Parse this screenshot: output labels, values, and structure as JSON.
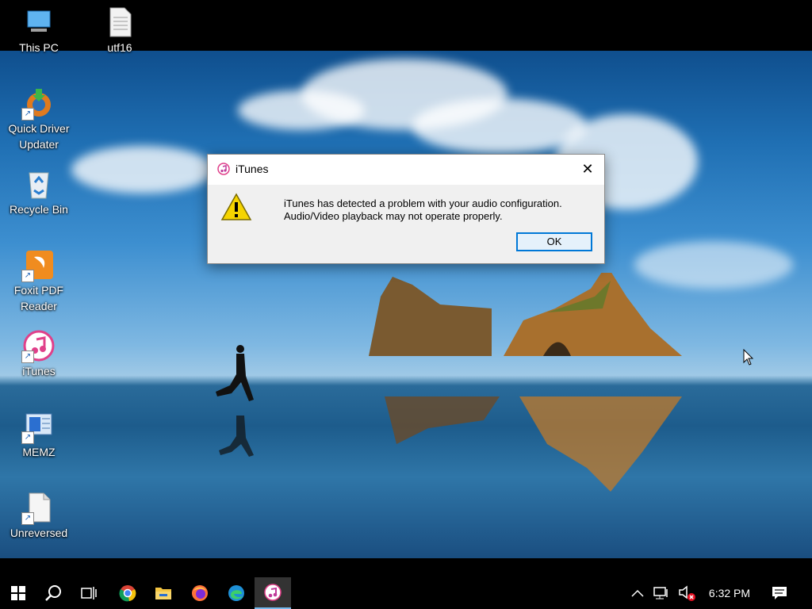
{
  "desktop": {
    "icons": [
      {
        "label": "This PC",
        "icon": "this-pc-icon"
      },
      {
        "label": "utf16",
        "icon": "text-file-icon"
      },
      {
        "label": "Quick Driver Updater",
        "label_line1": "Quick Driver",
        "label_line2": "Updater",
        "icon": "quick-driver-updater-icon"
      },
      {
        "label": "Recycle Bin",
        "icon": "recycle-bin-icon"
      },
      {
        "label": "Foxit PDF Reader",
        "label_line1": "Foxit PDF",
        "label_line2": "Reader",
        "icon": "foxit-pdf-icon"
      },
      {
        "label": "iTunes",
        "icon": "itunes-icon"
      },
      {
        "label": "MEMZ",
        "icon": "memz-icon"
      },
      {
        "label": "Unreversed",
        "icon": "file-icon"
      }
    ]
  },
  "dialog": {
    "title": "iTunes",
    "close_glyph": "✕",
    "message_line1": "iTunes has detected a problem with your audio configuration.",
    "message_line2": "Audio/Video playback may not operate properly.",
    "ok_label": "OK",
    "icon": "warning-icon"
  },
  "taskbar": {
    "clock": "6:32 PM",
    "pinned": [
      "start-icon",
      "search-icon",
      "task-view-icon",
      "chrome-icon",
      "file-explorer-icon",
      "firefox-icon",
      "edge-icon",
      "itunes-icon"
    ],
    "active": "itunes-icon",
    "tray": [
      "chevron-up-icon",
      "network-icon",
      "speaker-muted-icon",
      "notification-icon"
    ],
    "accent_color": "#76b9ed"
  }
}
